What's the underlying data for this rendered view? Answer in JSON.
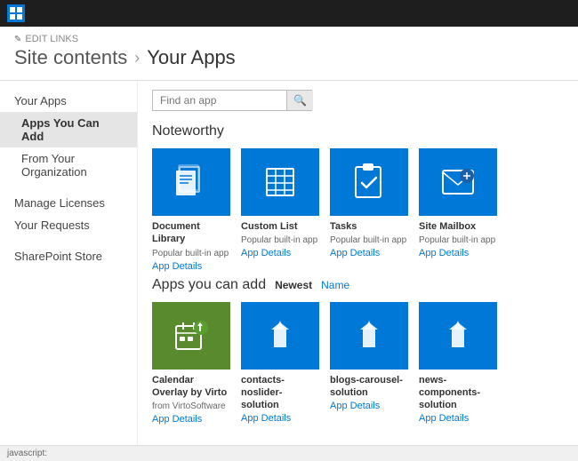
{
  "topbar": {
    "app_text": ""
  },
  "header": {
    "edit_links": "EDIT LINKS",
    "breadcrumb_root": "Site contents",
    "breadcrumb_separator": "›",
    "breadcrumb_current": "Your Apps"
  },
  "sidebar": {
    "items": [
      {
        "id": "your-apps",
        "label": "Your Apps",
        "active": false,
        "indented": false
      },
      {
        "id": "apps-you-can-add",
        "label": "Apps You Can Add",
        "active": true,
        "indented": true
      },
      {
        "id": "from-your-org",
        "label": "From Your Organization",
        "active": false,
        "indented": true
      },
      {
        "id": "manage-licenses",
        "label": "Manage Licenses",
        "active": false,
        "indented": false
      },
      {
        "id": "your-requests",
        "label": "Your Requests",
        "active": false,
        "indented": false
      },
      {
        "id": "sharepoint-store",
        "label": "SharePoint Store",
        "active": false,
        "indented": false
      }
    ]
  },
  "search": {
    "placeholder": "Find an app"
  },
  "noteworthy": {
    "title": "Noteworthy",
    "apps": [
      {
        "id": "document-library",
        "name": "Document Library",
        "subtitle": "Popular built-in app",
        "details_label": "App Details"
      },
      {
        "id": "custom-list",
        "name": "Custom List",
        "subtitle": "Popular built-in app",
        "details_label": "App Details"
      },
      {
        "id": "tasks",
        "name": "Tasks",
        "subtitle": "Popular built-in app",
        "details_label": "App Details"
      },
      {
        "id": "site-mailbox",
        "name": "Site Mailbox",
        "subtitle": "Popular built-in app",
        "details_label": "App Details"
      }
    ]
  },
  "apps_you_can_add": {
    "title": "Apps you can add",
    "filter_newest": "Newest",
    "filter_name": "Name",
    "apps": [
      {
        "id": "calendar-overlay",
        "name": "Calendar Overlay by Virto",
        "subtitle": "from VirtoSoftware",
        "details_label": "App Details",
        "color": "green"
      },
      {
        "id": "contacts-noslider",
        "name": "contacts-noslider-solution",
        "subtitle": "",
        "details_label": "App Details",
        "color": "blue"
      },
      {
        "id": "blogs-carousel",
        "name": "blogs-carousel-solution",
        "subtitle": "",
        "details_label": "App Details",
        "color": "blue"
      },
      {
        "id": "news-components",
        "name": "news-components-solution",
        "subtitle": "",
        "details_label": "App Details",
        "color": "blue"
      }
    ]
  },
  "bottombar": {
    "text": "javascript:"
  }
}
